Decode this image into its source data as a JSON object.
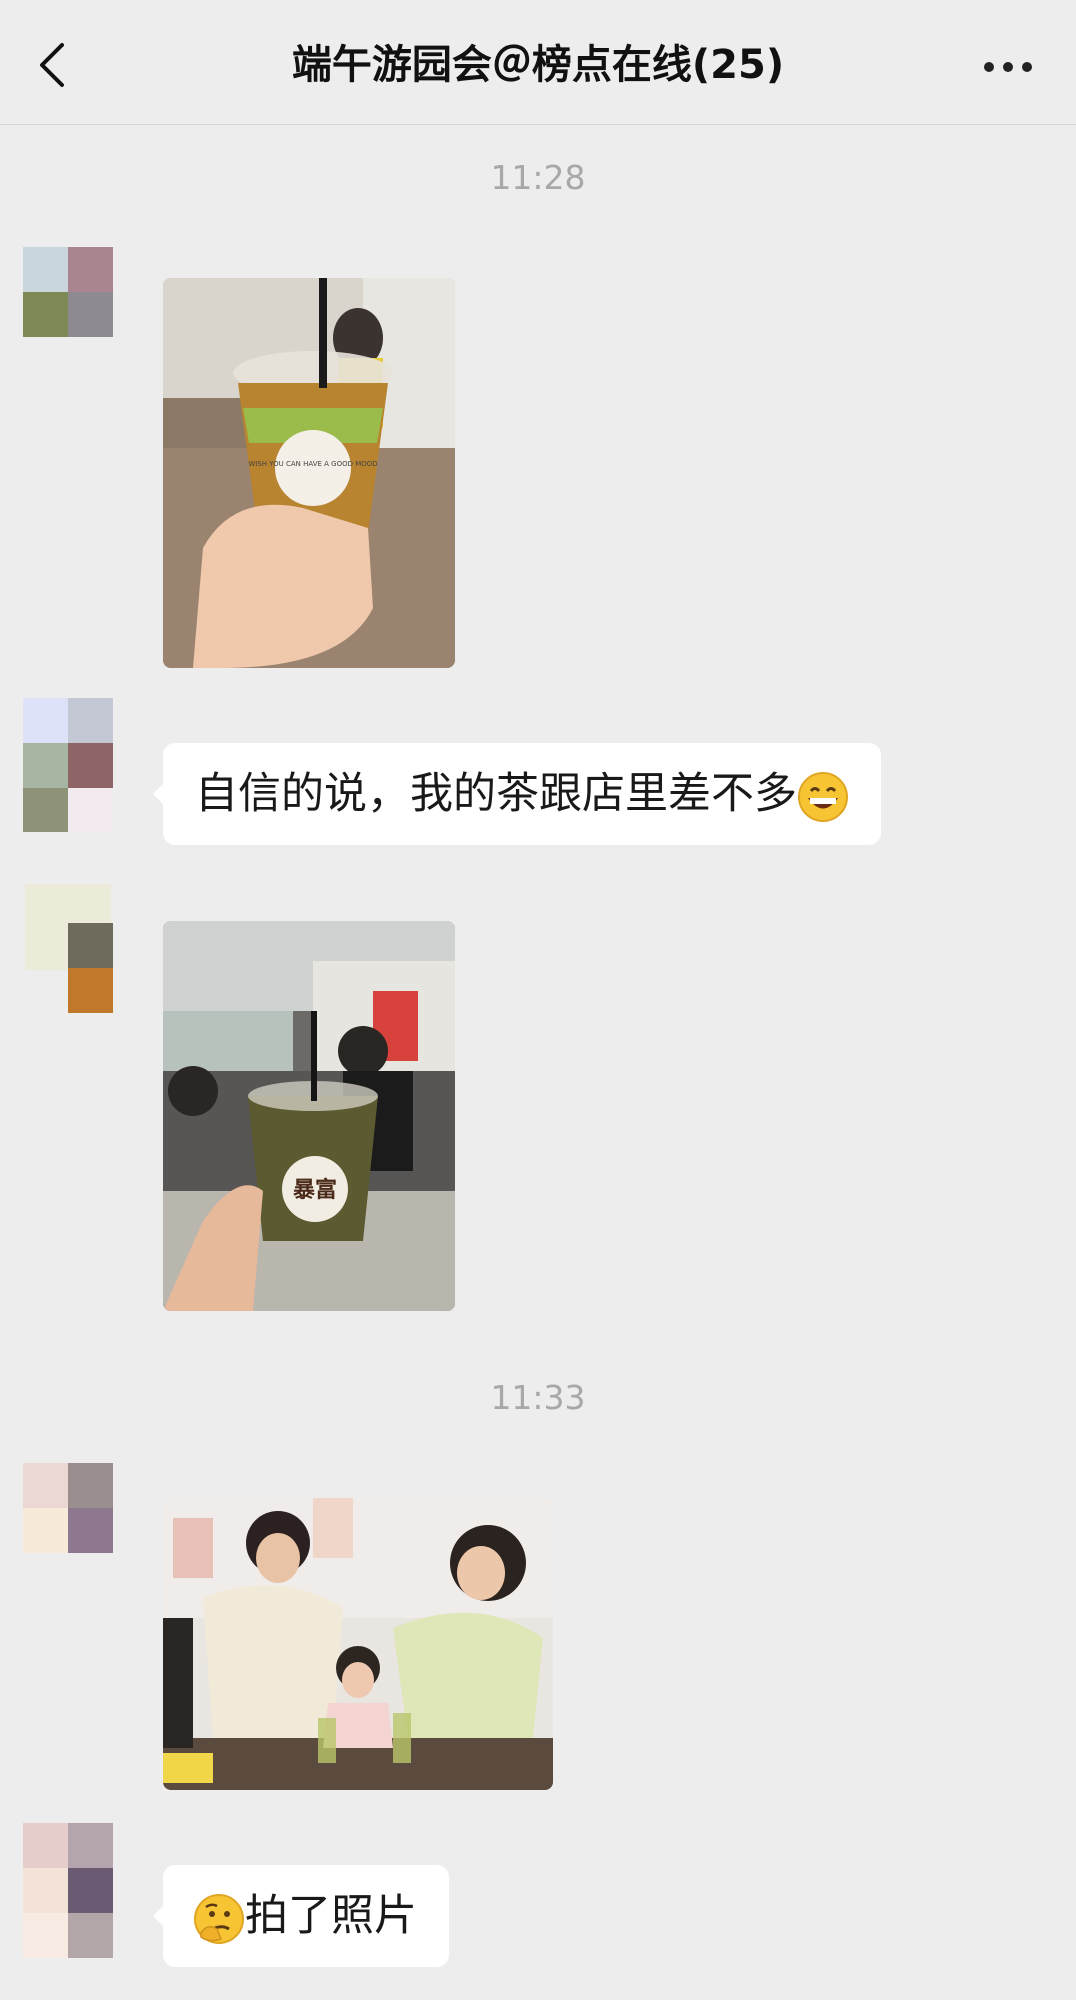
{
  "header": {
    "title": "端午游园会＠榜点在线(25)",
    "back_icon": "chevron-left-icon",
    "more_icon": "ellipsis-icon"
  },
  "timestamps": [
    "11:28",
    "11:33"
  ],
  "messages": [
    {
      "type": "image",
      "avatar": "group-avatar",
      "text": "WISH YOU CAN HAVE A GOOD MOOD"
    },
    {
      "type": "text",
      "text": "自信的说，我的茶跟店里差不多",
      "emoji": "grinning-face-emoji"
    },
    {
      "type": "image",
      "avatar": "group-avatar",
      "text": "暴富"
    },
    {
      "type": "image",
      "avatar": "group-avatar"
    },
    {
      "type": "text",
      "text": "拍了照片",
      "emoji": "thinking-face-emoji"
    }
  ],
  "colors": {
    "background": "#ededed",
    "bubble": "#ffffff",
    "timestamp": "#a8a8a8"
  }
}
